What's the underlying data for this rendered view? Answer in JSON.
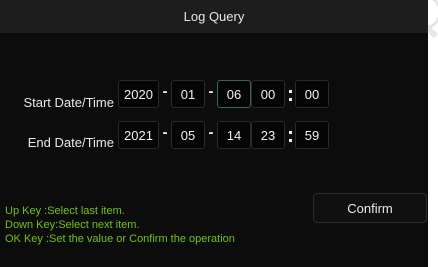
{
  "dialog": {
    "title": "Log Query"
  },
  "start": {
    "label": "Start Date/Time",
    "year": "2020",
    "month": "01",
    "day": "06",
    "hour": "00",
    "minute": "00"
  },
  "end": {
    "label": "End Date/Time",
    "year": "2021",
    "month": "05",
    "day": "14",
    "hour": "23",
    "minute": "59"
  },
  "separators": {
    "date": "-",
    "time": ":"
  },
  "confirm_label": "Confirm",
  "help": {
    "up": "Up Key  :Select last item.",
    "down": "Down Key:Select next item.",
    "ok": "OK Key  :Set the value or Confirm the operation"
  },
  "colors": {
    "panel_bg": "#0c0c0c",
    "title_bg": "#1d1d1d",
    "help_text": "#6fc21f",
    "focus_border": "#2f6a4a"
  }
}
